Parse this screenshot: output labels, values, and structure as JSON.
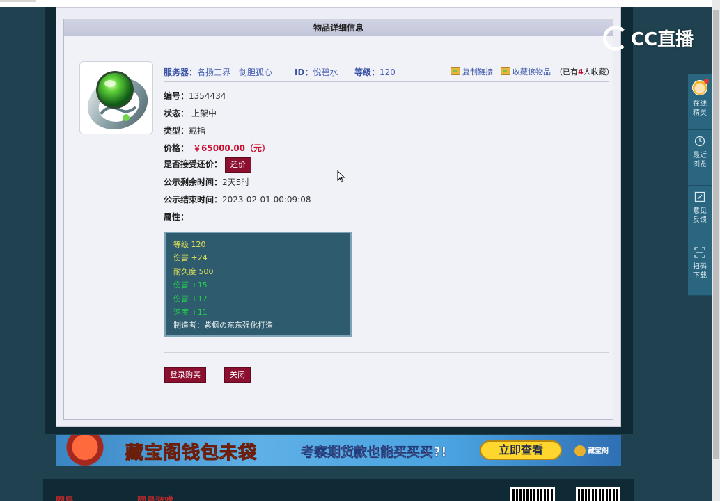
{
  "panel": {
    "title": "物品详细信息"
  },
  "item_header": {
    "server_label": "服务器：",
    "server_value": "名扬三界一剑胆孤心",
    "id_label": "ID：",
    "id_value": "悦碧水",
    "level_label": "等级：",
    "level_value": "120",
    "copy_link": "复制链接",
    "favorite": "收藏该物品",
    "fav_count_prefix": "（已有",
    "fav_count": "4",
    "fav_count_suffix": "人收藏）"
  },
  "details": {
    "number_label": "编号：",
    "number_value": "1354434",
    "status_label": "状态：",
    "status_value": "上架中",
    "type_label": "类型：",
    "type_value": "戒指",
    "price_label": "价格：",
    "price_value": "￥65000.00（元）",
    "bargain_label": "是否接受还价：",
    "bargain_button": "还价",
    "remaining_label": "公示剩余时间：",
    "remaining_value": "2天5时",
    "end_label": "公示结束时间：",
    "end_value": "2023-02-01 00:09:08",
    "attr_label": "属性："
  },
  "attributes": [
    {
      "text": "等级  120",
      "color": "#e2e25a"
    },
    {
      "text": "伤害  +24",
      "color": "#e2e25a"
    },
    {
      "text": "耐久度  500",
      "color": "#e2e25a"
    },
    {
      "text": "伤害  +15",
      "color": "#23d04a"
    },
    {
      "text": "伤害  +17",
      "color": "#23d04a"
    },
    {
      "text": "速度  +11",
      "color": "#23d04a"
    },
    {
      "text": "制造者：紫枫の东东强化打造",
      "color": "#e7ecef"
    }
  ],
  "actions": {
    "login_buy": "登录购买",
    "close": "关闭"
  },
  "banner": {
    "title": "藏宝阁钱包未袋",
    "subtitle": "考察期货款也能买买买?!",
    "cta": "立即查看",
    "logo": "藏宝阁"
  },
  "watermark": {
    "text": "CC直播"
  },
  "side_toolbar": [
    {
      "label_1": "在线",
      "label_2": "精灵",
      "icon": "avatar-icon"
    },
    {
      "label_1": "最近",
      "label_2": "浏览",
      "icon": "clock-icon"
    },
    {
      "label_1": "意见",
      "label_2": "反馈",
      "icon": "edit-icon"
    },
    {
      "label_1": "扫码",
      "label_2": "下载",
      "icon": "scan-icon"
    }
  ],
  "footer": {
    "logo_left": "网易",
    "logo_right": "网易游戏"
  },
  "colors": {
    "page_bg": "#1f4150",
    "panel_bg": "#f1f2f8",
    "header_bg": "#c3c6da",
    "button_red": "#8c0f2f",
    "price_red": "#c8102e",
    "attr_box_bg": "#2e5b6e"
  }
}
